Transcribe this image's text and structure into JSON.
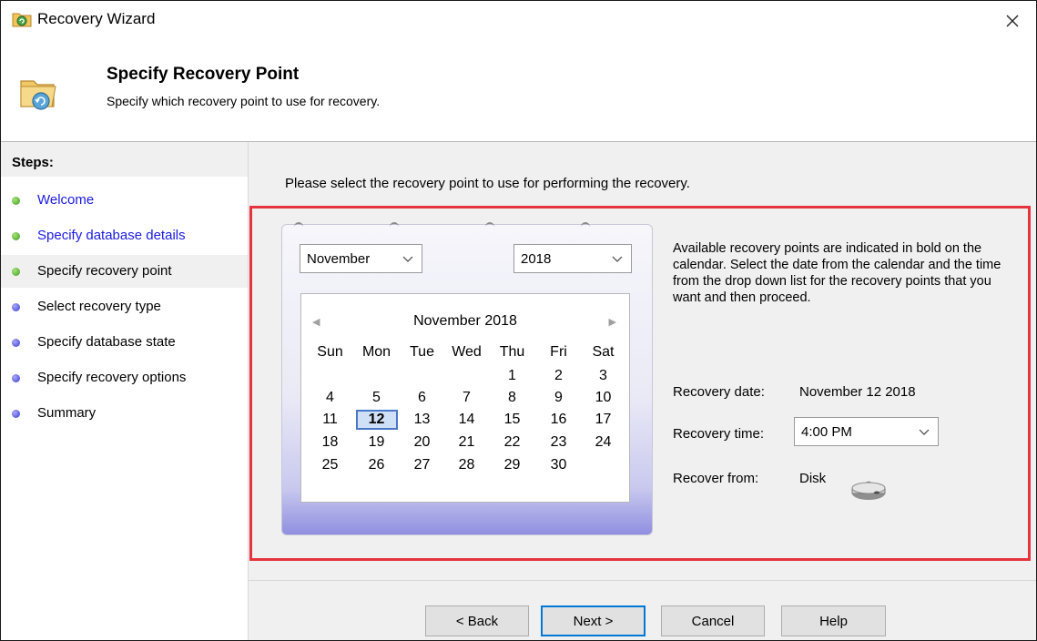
{
  "window": {
    "title": "Recovery Wizard"
  },
  "header": {
    "title": "Specify Recovery Point",
    "subtitle": "Specify which recovery point to use for recovery."
  },
  "sidebar": {
    "steps_title": "Steps:",
    "items": [
      {
        "label": "Welcome",
        "state": "done-link"
      },
      {
        "label": "Specify database details",
        "state": "done-link"
      },
      {
        "label": "Specify recovery point",
        "state": "current"
      },
      {
        "label": "Select recovery type",
        "state": "pending"
      },
      {
        "label": "Specify database state",
        "state": "pending"
      },
      {
        "label": "Specify recovery options",
        "state": "pending"
      },
      {
        "label": "Summary",
        "state": "pending"
      }
    ]
  },
  "main": {
    "intro": "Please select the recovery point to use for performing the recovery.",
    "month_select": "November",
    "year_select": "2018",
    "calendar": {
      "title": "November 2018",
      "days_of_week": [
        "Sun",
        "Mon",
        "Tue",
        "Wed",
        "Thu",
        "Fri",
        "Sat"
      ],
      "weeks": [
        [
          "",
          "",
          "",
          "",
          "1",
          "2",
          "3"
        ],
        [
          "4",
          "5",
          "6",
          "7",
          "8",
          "9",
          "10"
        ],
        [
          "11",
          "12",
          "13",
          "14",
          "15",
          "16",
          "17"
        ],
        [
          "18",
          "19",
          "20",
          "21",
          "22",
          "23",
          "24"
        ],
        [
          "25",
          "26",
          "27",
          "28",
          "29",
          "30",
          ""
        ]
      ],
      "selected_day": "12"
    },
    "info": "Available recovery points are indicated in bold on the calendar. Select the date from the calendar and the time from the drop down list for the recovery points that you want and then proceed.",
    "recovery_date_label": "Recovery date:",
    "recovery_date_value": "November 12 2018",
    "recovery_time_label": "Recovery time:",
    "recovery_time_value": "4:00 PM",
    "recover_from_label": "Recover from:",
    "recover_from_value": "Disk"
  },
  "buttons": {
    "back": "< Back",
    "next": "Next >",
    "cancel": "Cancel",
    "help": "Help"
  },
  "colors": {
    "highlight_box": "#e5343d",
    "link": "#1a1ae6",
    "selected_day_border": "#4a78c9"
  }
}
